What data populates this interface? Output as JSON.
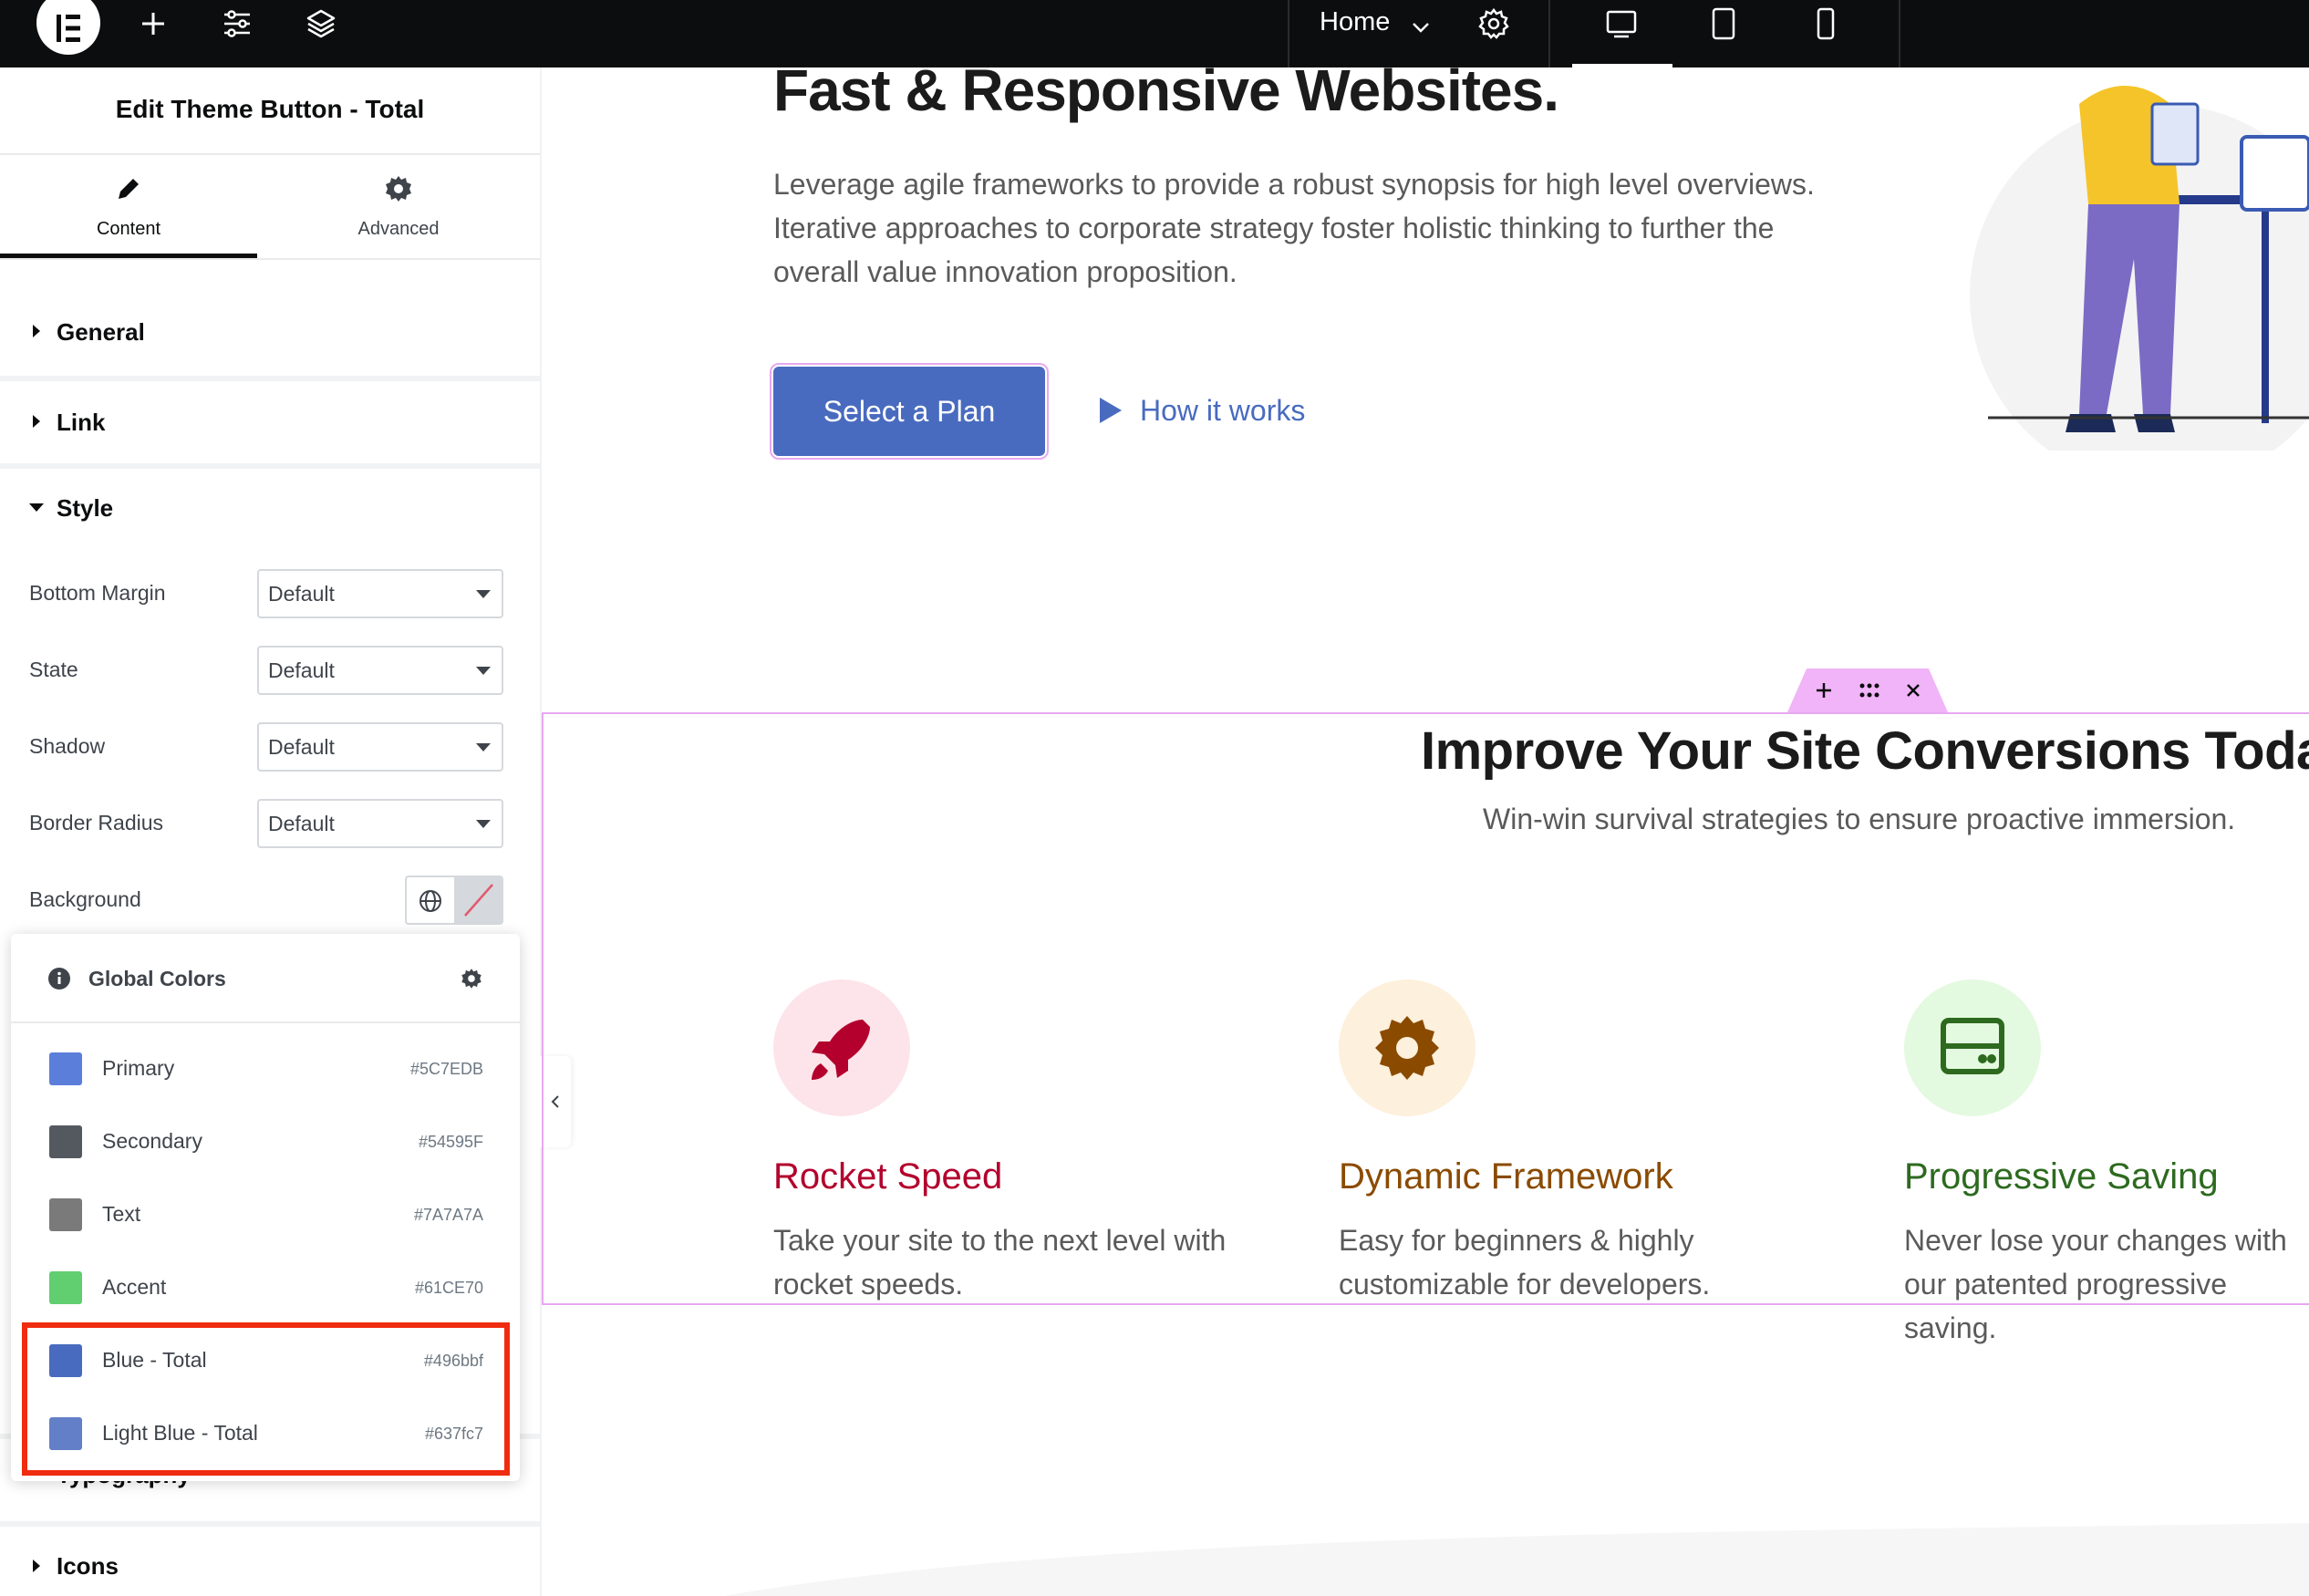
{
  "topbar": {
    "home_label": "Home",
    "icons": [
      "elementor-logo-icon",
      "plus-icon",
      "sliders-icon",
      "layers-icon",
      "chevron-down-icon",
      "gear-icon",
      "desktop-icon",
      "tablet-icon",
      "mobile-icon"
    ]
  },
  "panel": {
    "title": "Edit Theme Button - Total",
    "tabs": [
      {
        "label": "Content",
        "icon": "pencil-icon",
        "active": true
      },
      {
        "label": "Advanced",
        "icon": "gear-icon",
        "active": false
      }
    ],
    "sections": {
      "general": "General",
      "link": "Link",
      "style": "Style",
      "typography": "Typography",
      "icons": "Icons"
    },
    "controls": [
      {
        "label": "Bottom Margin",
        "value": "Default"
      },
      {
        "label": "State",
        "value": "Default"
      },
      {
        "label": "Shadow",
        "value": "Default"
      },
      {
        "label": "Border Radius",
        "value": "Default"
      }
    ],
    "background_label": "Background"
  },
  "global_colors": {
    "title": "Global Colors",
    "colors": [
      {
        "name": "Primary",
        "hex": "#5C7EDB",
        "swatch": "#5c7edb"
      },
      {
        "name": "Secondary",
        "hex": "#54595F",
        "swatch": "#54595f"
      },
      {
        "name": "Text",
        "hex": "#7A7A7A",
        "swatch": "#7a7a7a"
      },
      {
        "name": "Accent",
        "hex": "#61CE70",
        "swatch": "#61ce70"
      },
      {
        "name": "Blue - Total",
        "hex": "#496bbf",
        "swatch": "#496bbf"
      },
      {
        "name": "Light Blue - Total",
        "hex": "#637fc7",
        "swatch": "#637fc7"
      }
    ]
  },
  "canvas": {
    "hero_title": "Fast & Responsive Websites.",
    "hero_text": "Leverage agile frameworks to provide a robust synopsis for high level overviews. Iterative approaches to corporate strategy foster holistic thinking to further the overall value innovation proposition.",
    "primary_button": "Select a Plan",
    "secondary_link": "How it works",
    "section_title": "Improve Your Site Conversions Today",
    "section_subtitle": "Win-win survival strategies to ensure proactive immersion.",
    "features": [
      {
        "title": "Rocket Speed",
        "text": "Take your site to the next level with rocket speeds.",
        "icon": "rocket-icon",
        "color": "#b3002d",
        "bg": "#fde4ea"
      },
      {
        "title": "Dynamic Framework",
        "text": "Easy for beginners & highly customizable for developers.",
        "icon": "gear-icon",
        "color": "#8a4b00",
        "bg": "#fdf0dc"
      },
      {
        "title": "Progressive Saving",
        "text": "Never lose your changes with our patented progressive saving.",
        "icon": "hard-drive-icon",
        "color": "#2d6a1f",
        "bg": "#e4fae0"
      }
    ]
  }
}
